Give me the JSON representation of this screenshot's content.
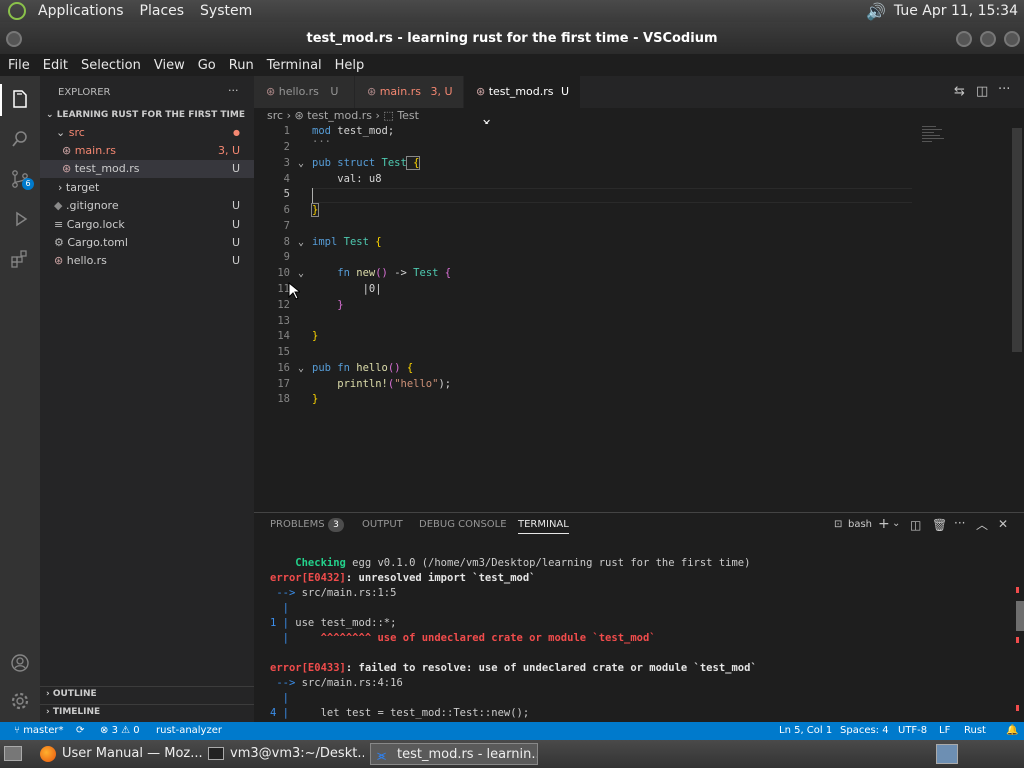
{
  "top_panel": {
    "menus": [
      "Applications",
      "Places",
      "System"
    ],
    "clock": "Tue Apr 11, 15:34"
  },
  "window": {
    "title": "test_mod.rs - learning rust for the first time - VSCodium"
  },
  "menubar": [
    "File",
    "Edit",
    "Selection",
    "View",
    "Go",
    "Run",
    "Terminal",
    "Help"
  ],
  "activity": {
    "scm_badge": "6"
  },
  "sidebar": {
    "title": "EXPLORER",
    "more": "···",
    "root": "LEARNING RUST FOR THE FIRST TIME",
    "items": [
      {
        "label": "src",
        "badge": "●"
      },
      {
        "label": "main.rs",
        "badge": "3, U"
      },
      {
        "label": "test_mod.rs",
        "badge": "U"
      },
      {
        "label": "target",
        "badge": ""
      },
      {
        "label": ".gitignore",
        "badge": "U"
      },
      {
        "label": "Cargo.lock",
        "badge": "U"
      },
      {
        "label": "Cargo.toml",
        "badge": "U"
      },
      {
        "label": "hello.rs",
        "badge": "U"
      }
    ],
    "outline": "OUTLINE",
    "timeline": "TIMELINE"
  },
  "tabs": [
    {
      "label": "hello.rs",
      "badge": "U"
    },
    {
      "label": "main.rs",
      "badge": "3, U"
    },
    {
      "label": "test_mod.rs",
      "badge": "U",
      "close": "✕"
    }
  ],
  "breadcrumb": {
    "folder": "src",
    "file": "test_mod.rs",
    "symbol": "Test"
  },
  "editor": {
    "line_numbers": [
      "1",
      "2",
      "3",
      "4",
      "5",
      "6",
      "7",
      "8",
      "9",
      "10",
      "11",
      "12",
      "13",
      "14",
      "15",
      "16",
      "17",
      "18"
    ],
    "collapsed_marker": "···",
    "code": {
      "l1_kw": "mod",
      "l1_rest": " test_mod;",
      "l3_kw": "pub struct",
      "l3_ty": " Test",
      "l3_br": " {",
      "l4": "    val: u8",
      "l6_br": "}",
      "l8_kw": "impl",
      "l8_ty": " Test",
      "l8_br": " {",
      "l10_kw": "    fn",
      "l10_fn": " new",
      "l10_p": "()",
      "l10_arrow": " ->",
      "l10_ty": " Test",
      "l10_br": " {",
      "l11": "        |0|",
      "l12": "    }",
      "l14_br": "}",
      "l16_kw": "pub fn",
      "l16_fn": " hello",
      "l16_p": "()",
      "l16_br": " {",
      "l17_fn": "    println!",
      "l17_p": "(",
      "l17_str": "\"hello\"",
      "l17_end": ");",
      "l18_br": "}"
    }
  },
  "panel": {
    "tabs": [
      "PROBLEMS",
      "OUTPUT",
      "DEBUG CONSOLE",
      "TERMINAL"
    ],
    "problems_count": "3",
    "shell": "bash",
    "terminal": {
      "l1_green": "    Checking",
      "l1_rest": " egg v0.1.0 (/home/vm3/Desktop/learning rust for the first time)",
      "l2_red": "error[E0432]",
      "l2_bold": ": unresolved import `test_mod`",
      "l3_blue": " -->",
      "l3_rest": " src/main.rs:1:5",
      "l4_blue": "  |",
      "l5_blue": "1 |",
      "l5_rest": " use test_mod::*;",
      "l6_blue": "  |",
      "l6_red": "     ^^^^^^^^ use of undeclared crate or module `test_mod`",
      "l8_red": "error[E0433]",
      "l8_bold": ": failed to resolve: use of undeclared crate or module `test_mod`",
      "l9_blue": " -->",
      "l9_rest": " src/main.rs:4:16",
      "l10_blue": "  |",
      "l11_blue": "4 |",
      "l11_rest": "     let test = test_mod::Test::new();"
    }
  },
  "status": {
    "branch": "master*",
    "errors": "3",
    "warnings": "0",
    "analyzer": "rust-analyzer",
    "position": "Ln 5, Col 1",
    "spaces": "Spaces: 4",
    "encoding": "UTF-8",
    "eol": "LF",
    "language": "Rust"
  },
  "taskbar": [
    {
      "label": "User Manual — Moz..."
    },
    {
      "label": "vm3@vm3:~/Deskt..."
    },
    {
      "label": "test_mod.rs - learnin..."
    }
  ],
  "colors": {
    "accent": "#007acc",
    "sidebar": "#252526",
    "editor": "#1e1e1e",
    "error": "#f14c4c",
    "added": "#73c991",
    "modified": "#e2c08d"
  }
}
